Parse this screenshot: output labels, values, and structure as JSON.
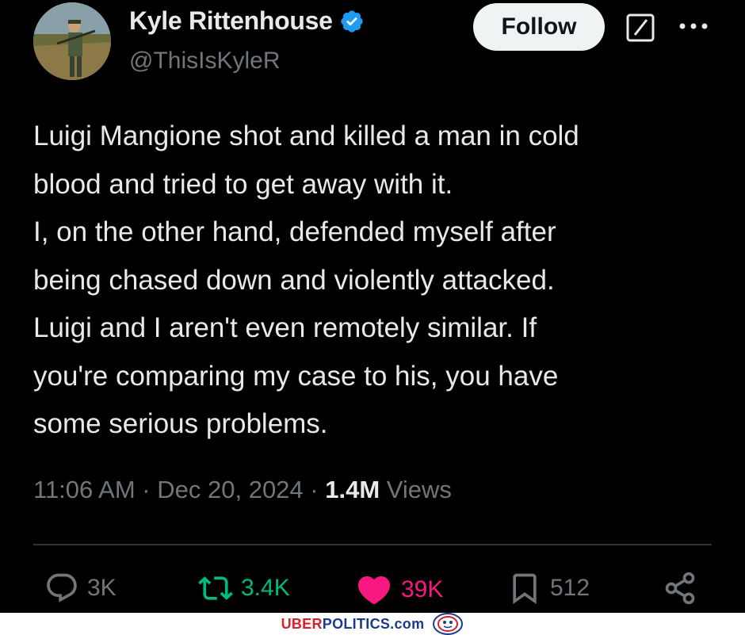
{
  "author": {
    "name": "Kyle Rittenhouse",
    "handle": "@ThisIsKyleR",
    "verified": true
  },
  "follow_label": "Follow",
  "tweet": {
    "lines": [
      "Luigi Mangione shot and killed a man in cold",
      "blood and tried to get away with it.",
      "I, on the other hand, defended myself after",
      "being chased down and violently attacked.",
      "Luigi and I aren't even remotely similar. If",
      "you're comparing my case to his, you have",
      "some serious problems."
    ]
  },
  "meta": {
    "time": "11:06 AM",
    "sep1": " · ",
    "date": "Dec 20, 2024",
    "sep2": " · ",
    "views_count": "1.4M",
    "views_label": " Views"
  },
  "actions": {
    "replies": "3K",
    "reposts": "3.4K",
    "likes": "39K",
    "bookmarks": "512"
  },
  "colors": {
    "background": "#000000",
    "text": "#e7e9ea",
    "muted": "#71767b",
    "verified": "#1d9bf0",
    "repost": "#00ba7c",
    "like": "#f91880"
  },
  "icons": [
    "verified-badge-icon",
    "grok-icon",
    "more-icon",
    "reply-icon",
    "repost-icon",
    "like-icon",
    "bookmark-icon",
    "share-icon"
  ],
  "watermark": {
    "brand_prefix": "UBER",
    "brand_rest": "POLITICS.com"
  }
}
